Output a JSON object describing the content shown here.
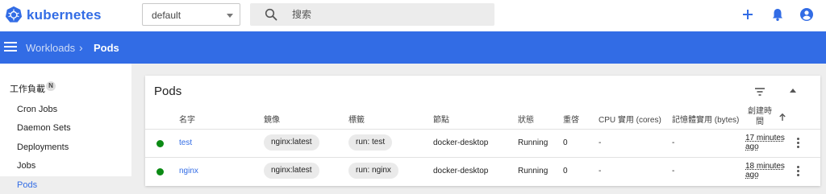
{
  "app": {
    "brand": "kubernetes",
    "namespace": "default",
    "search_placeholder": "搜索"
  },
  "breadcrumb": {
    "parent": "Workloads",
    "separator": "›",
    "current": "Pods"
  },
  "sidebar": {
    "section_label": "工作負載",
    "section_badge": "N",
    "items": [
      {
        "label": "Cron Jobs"
      },
      {
        "label": "Daemon Sets"
      },
      {
        "label": "Deployments"
      },
      {
        "label": "Jobs"
      },
      {
        "label": "Pods",
        "active": true
      }
    ]
  },
  "card": {
    "title": "Pods",
    "columns": {
      "name": "名字",
      "image": "鏡像",
      "labels": "標籤",
      "node": "節點",
      "status": "狀態",
      "restarts": "重啓",
      "cpu": "CPU 實用 (cores)",
      "memory": "記憶體實用 (bytes)",
      "created": "創建時間"
    },
    "rows": [
      {
        "status_color": "#0b8a14",
        "name": "test",
        "image": "nginx:latest",
        "labels": "run: test",
        "node": "docker-desktop",
        "status": "Running",
        "restarts": "0",
        "cpu": "-",
        "memory": "-",
        "created": "17 minutes ago"
      },
      {
        "status_color": "#0b8a14",
        "name": "nginx",
        "image": "nginx:latest",
        "labels": "run: nginx",
        "node": "docker-desktop",
        "status": "Running",
        "restarts": "0",
        "cpu": "-",
        "memory": "-",
        "created": "18 minutes ago"
      }
    ]
  },
  "colors": {
    "brand": "#326ce5",
    "status_running": "#0b8a14"
  },
  "icons": {
    "logo": "kubernetes-logo-icon",
    "search": "search-icon",
    "add": "plus-icon",
    "notifications": "bell-icon",
    "account": "account-circle-icon",
    "menu": "hamburger-menu-icon",
    "filter": "filter-icon",
    "collapse": "chevron-up-icon",
    "sort": "arrow-up-icon",
    "row_actions": "more-vert-icon"
  }
}
